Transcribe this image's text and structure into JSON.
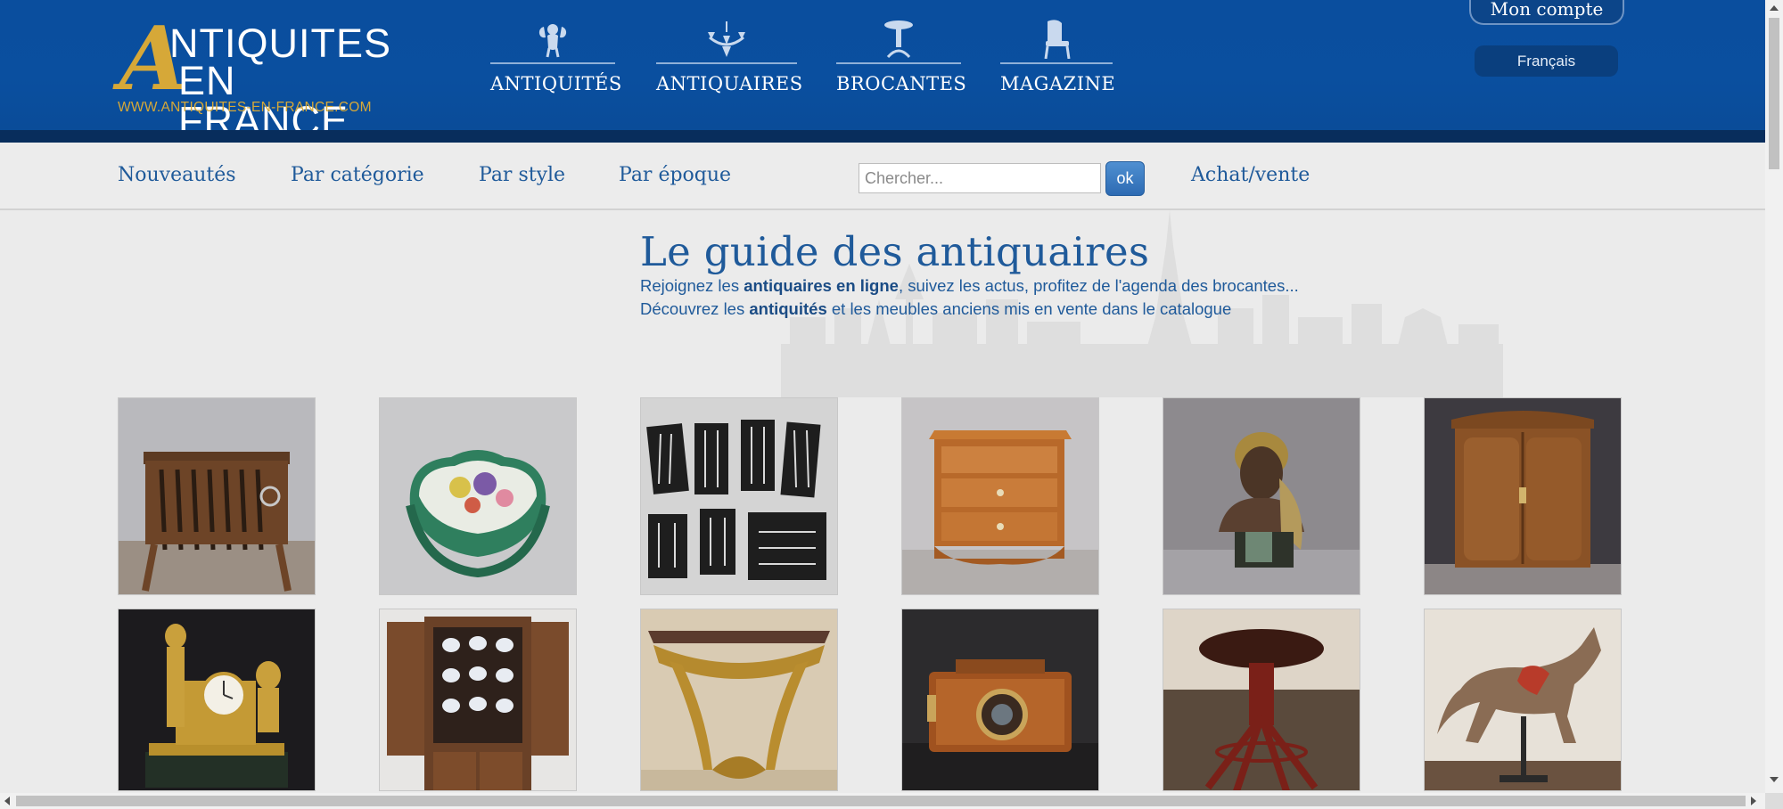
{
  "logo": {
    "letter": "A",
    "line1": "NTIQUITES",
    "line2": "EN FRANCE",
    "url": "WWW.ANTIQUITES-EN-FRANCE.COM"
  },
  "main_nav": [
    {
      "label": "ANTIQUITÉS",
      "icon": "cherub-icon"
    },
    {
      "label": "ANTIQUAIRES",
      "icon": "chandelier-icon"
    },
    {
      "label": "BROCANTES",
      "icon": "pedestal-table-icon"
    },
    {
      "label": "MAGAZINE",
      "icon": "armchair-icon"
    }
  ],
  "account": {
    "label": "Mon compte"
  },
  "language": {
    "label": "Français"
  },
  "sub_nav": [
    {
      "label": "Nouveautés"
    },
    {
      "label": "Par catégorie"
    },
    {
      "label": "Par style"
    },
    {
      "label": "Par époque"
    },
    {
      "label": "Achat/vente"
    }
  ],
  "search": {
    "placeholder": "Chercher...",
    "button_label": "ok"
  },
  "hero": {
    "title": "Le guide des antiquaires",
    "line1_before": "Rejoignez les ",
    "line1_bold": "antiquaires en ligne",
    "line1_after": ", suivez les actus, profitez de l'agenda des brocantes...",
    "line2_before": "Découvrez les ",
    "line2_bold": "antiquités",
    "line2_after": " et les meubles anciens mis en vente dans le catalogue"
  },
  "products": [
    {
      "name": "gun-rack-image"
    },
    {
      "name": "porcelain-box-image"
    },
    {
      "name": "silverware-set-image"
    },
    {
      "name": "small-chest-image"
    },
    {
      "name": "bust-sculpture-image"
    },
    {
      "name": "walnut-armoire-image"
    },
    {
      "name": "bronze-clock-image"
    },
    {
      "name": "dresser-cabinet-image"
    },
    {
      "name": "gilt-console-image"
    },
    {
      "name": "antique-camera-image"
    },
    {
      "name": "piano-stool-image"
    },
    {
      "name": "carousel-horse-image"
    }
  ],
  "colors": {
    "header_blue": "#0a4e9e",
    "header_dark": "#082d5c",
    "gold": "#d6a838",
    "link_blue": "#1f5a9a"
  }
}
